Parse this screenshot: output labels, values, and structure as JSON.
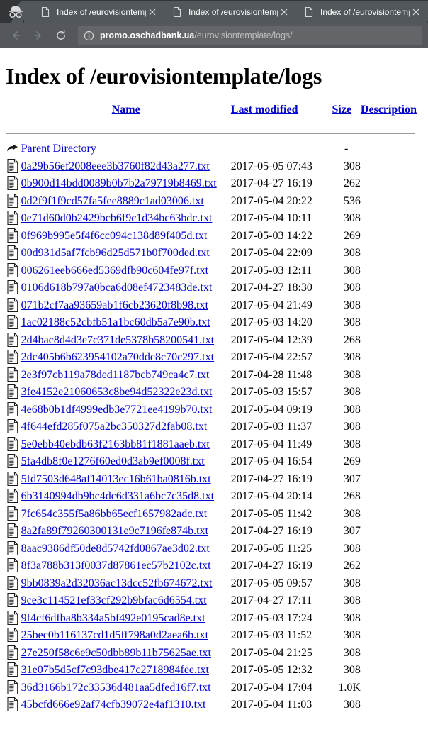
{
  "browser": {
    "incognito_icon": "incognito-hat-icon",
    "tabs": [
      {
        "title": "Index of /eurovisiontemplate/logs",
        "favicon": "page-icon",
        "close": "close-icon",
        "active": false
      },
      {
        "title": "Index of /eurovisiontemplate/logs",
        "favicon": "page-icon",
        "close": "close-icon",
        "active": false
      },
      {
        "title": "Index of /eurovisiontemplate/logs",
        "favicon": "page-icon",
        "close": "close-icon",
        "active": false
      }
    ],
    "toolbar": {
      "back_icon": "back-arrow-icon",
      "forward_icon": "forward-arrow-icon",
      "reload_icon": "reload-icon",
      "security_icon": "info-circle-icon",
      "url_host": "promo.oschadbank.ua",
      "url_path": "/eurovisiontemplate/logs/"
    }
  },
  "page": {
    "title": "Index of /eurovisiontemplate/logs",
    "columns": {
      "name": "Name",
      "last_modified": "Last modified",
      "size": "Size",
      "description": "Description"
    },
    "parent": {
      "icon": "parent-directory-icon",
      "label": "Parent Directory",
      "date": "",
      "size": "-",
      "description": ""
    },
    "files": [
      {
        "name": "0a29b56ef2008eee3b3760f82d43a277.txt",
        "date": "2017-05-05 07:43",
        "size": "308"
      },
      {
        "name": "0b900d14bdd0089b0b7b2a79719b8469.txt",
        "date": "2017-04-27 16:19",
        "size": "262"
      },
      {
        "name": "0d2f9f1f9cd57fa5fee8889c1ad03006.txt",
        "date": "2017-05-04 20:22",
        "size": "536"
      },
      {
        "name": "0e71d60d0b2429bcb6f9c1d34bc63bdc.txt",
        "date": "2017-05-04 10:11",
        "size": "308"
      },
      {
        "name": "0f969b995e5f4f6cc094c138d89f405d.txt",
        "date": "2017-05-03 14:22",
        "size": "269"
      },
      {
        "name": "00d931d5af7fcb96d25d571b0f700ded.txt",
        "date": "2017-05-04 22:09",
        "size": "308"
      },
      {
        "name": "006261eeb666ed5369dfb90c604fe97f.txt",
        "date": "2017-05-03 12:11",
        "size": "308"
      },
      {
        "name": "0106d618b797a0bca6d08ef4723483de.txt",
        "date": "2017-04-27 18:30",
        "size": "308"
      },
      {
        "name": "071b2cf7aa93659ab1f6cb23620f8b98.txt",
        "date": "2017-05-04 21:49",
        "size": "308"
      },
      {
        "name": "1ac02188c52cbfb51a1bc60db5a7e90b.txt",
        "date": "2017-05-03 14:20",
        "size": "308"
      },
      {
        "name": "2d4bac8d4d3e7c371de5378b58200541.txt",
        "date": "2017-05-04 12:39",
        "size": "268"
      },
      {
        "name": "2dc405b6b623954102a70ddc8c70c297.txt",
        "date": "2017-05-04 22:57",
        "size": "308"
      },
      {
        "name": "2e3f97cb119a78ded1187bcb749ca4c7.txt",
        "date": "2017-04-28 11:48",
        "size": "308"
      },
      {
        "name": "3fe4152e21060653c8be94d52322e23d.txt",
        "date": "2017-05-03 15:57",
        "size": "308"
      },
      {
        "name": "4e68b0b1df4999edb3e7721ee4199b70.txt",
        "date": "2017-05-04 09:19",
        "size": "308"
      },
      {
        "name": "4f644efd285f075a2bc350327d2fab08.txt",
        "date": "2017-05-03 11:37",
        "size": "308"
      },
      {
        "name": "5e0ebb40ebdb63f2163bb81f1881aaeb.txt",
        "date": "2017-05-04 11:49",
        "size": "308"
      },
      {
        "name": "5fa4db8f0e1276f60ed0d3ab9ef0008f.txt",
        "date": "2017-05-04 16:54",
        "size": "269"
      },
      {
        "name": "5fd7503d648af14013ec16b61ba0816b.txt",
        "date": "2017-04-27 16:19",
        "size": "307"
      },
      {
        "name": "6b3140994db9bc4dc6d331a6bc7c35d8.txt",
        "date": "2017-05-04 20:14",
        "size": "268"
      },
      {
        "name": "7fc654c355f5a86bb65ecf1657982adc.txt",
        "date": "2017-05-05 11:42",
        "size": "308"
      },
      {
        "name": "8a2fa89f79260300131e9c7196fe874b.txt",
        "date": "2017-04-27 16:19",
        "size": "307"
      },
      {
        "name": "8aac9386df50de8d5742fd0867ae3d02.txt",
        "date": "2017-05-05 11:25",
        "size": "308"
      },
      {
        "name": "8f3a788b313f0037d87861ec57b2102c.txt",
        "date": "2017-04-27 16:19",
        "size": "262"
      },
      {
        "name": "9bb0839a2d32036ac13dcc52fb674672.txt",
        "date": "2017-05-05 09:57",
        "size": "308"
      },
      {
        "name": "9ce3c114521ef33cf292b9bfac6d6554.txt",
        "date": "2017-04-27 17:11",
        "size": "308"
      },
      {
        "name": "9f4cf6dfba8b334a5bf492e0195cad8e.txt",
        "date": "2017-05-03 17:24",
        "size": "308"
      },
      {
        "name": "25bec0b116137cd1d5ff798a0d2aea6b.txt",
        "date": "2017-05-03 11:52",
        "size": "308"
      },
      {
        "name": "27e250f58c6e9c50dbb89b11b75625ae.txt",
        "date": "2017-05-04 21:25",
        "size": "308"
      },
      {
        "name": "31e07b5d5cf7c93dbe417c2718984fee.txt",
        "date": "2017-05-05 12:32",
        "size": "308"
      },
      {
        "name": "36d3166b172c33536d481aa5dfed16f7.txt",
        "date": "2017-05-04 17:04",
        "size": "1.0K"
      },
      {
        "name": "45bcfd666e92af74cfb39072e4af1310.txt",
        "date": "2017-05-04 11:03",
        "size": "308"
      }
    ]
  },
  "colors": {
    "link": "#0000cc",
    "tab_bar": "#323639",
    "tab_inactive": "#52575b",
    "toolbar": "#54585c",
    "omnibox": "#636669",
    "rule": "#999999"
  }
}
